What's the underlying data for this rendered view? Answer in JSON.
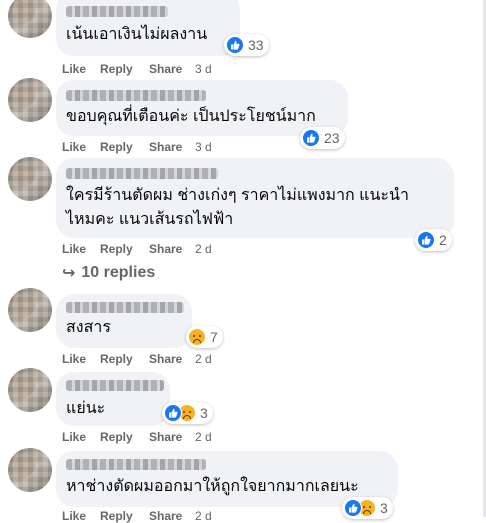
{
  "comments": [
    {
      "text": "เน้นเอาเงินไม่ผลงาน",
      "reactions": {
        "like": true,
        "sad": false,
        "count": "33"
      },
      "actions": {
        "like": "Like",
        "reply": "Reply",
        "share": "Share",
        "time": "3 d"
      }
    },
    {
      "text": "ขอบคุณที่เตือนค่ะ เป็นประโยชน์มาก",
      "reactions": {
        "like": true,
        "sad": false,
        "count": "23"
      },
      "actions": {
        "like": "Like",
        "reply": "Reply",
        "share": "Share",
        "time": "3 d"
      }
    },
    {
      "text_line1": "ใครมีร้านตัดผม ช่างเก่งๆ ราคาไม่แพงมาก แนะนำ",
      "text_line2": "ไหมคะ แนวเส้นรถไฟฟ้า",
      "reactions": {
        "like": true,
        "sad": false,
        "count": "2"
      },
      "actions": {
        "like": "Like",
        "reply": "Reply",
        "share": "Share",
        "time": "2 d"
      },
      "replies_label": "10 replies"
    },
    {
      "text": "สงสาร",
      "reactions": {
        "like": false,
        "sad": true,
        "count": "7"
      },
      "actions": {
        "like": "Like",
        "reply": "Reply",
        "share": "Share",
        "time": "2 d"
      }
    },
    {
      "text": "แย่นะ",
      "reactions": {
        "like": true,
        "sad": true,
        "count": "3"
      },
      "actions": {
        "like": "Like",
        "reply": "Reply",
        "share": "Share",
        "time": "2 d"
      }
    },
    {
      "text": "หาช่างตัดผมออกมาให้ถูกใจยากมากเลยนะ",
      "reactions": {
        "like": true,
        "sad": true,
        "count": "3"
      },
      "actions": {
        "like": "Like",
        "reply": "Reply",
        "share": "Share",
        "time": "2 d"
      }
    }
  ],
  "icons": {
    "like": "like-thumb-icon",
    "sad": "sad-face-icon",
    "reply_arrow": "reply-arrow-icon"
  },
  "colors": {
    "bubble": "#f0f2f5",
    "meta_text": "#65676b",
    "like_blue": "#1877f2",
    "sad_yellow": "#f7b125"
  }
}
